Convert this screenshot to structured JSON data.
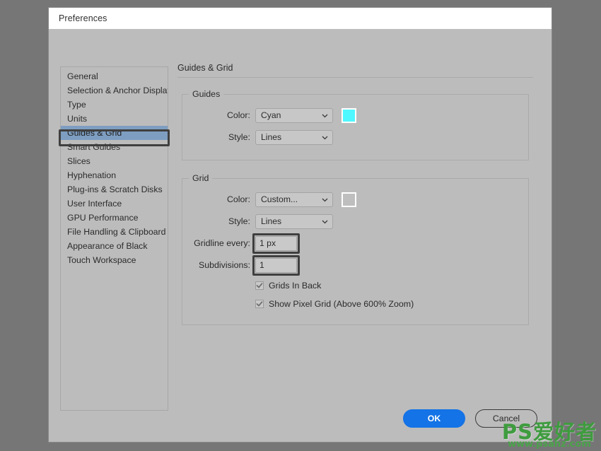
{
  "window": {
    "title": "Preferences"
  },
  "sidebar": {
    "items": [
      {
        "label": "General",
        "selected": false
      },
      {
        "label": "Selection & Anchor Display",
        "selected": false
      },
      {
        "label": "Type",
        "selected": false
      },
      {
        "label": "Units",
        "selected": false
      },
      {
        "label": "Guides & Grid",
        "selected": true
      },
      {
        "label": "Smart Guides",
        "selected": false
      },
      {
        "label": "Slices",
        "selected": false
      },
      {
        "label": "Hyphenation",
        "selected": false
      },
      {
        "label": "Plug-ins & Scratch Disks",
        "selected": false
      },
      {
        "label": "User Interface",
        "selected": false
      },
      {
        "label": "GPU Performance",
        "selected": false
      },
      {
        "label": "File Handling & Clipboard",
        "selected": false
      },
      {
        "label": "Appearance of Black",
        "selected": false
      },
      {
        "label": "Touch Workspace",
        "selected": false
      }
    ]
  },
  "panel": {
    "title": "Guides & Grid",
    "guides": {
      "legend": "Guides",
      "color_label": "Color:",
      "color_value": "Cyan",
      "color_swatch": "#4ff7ff",
      "style_label": "Style:",
      "style_value": "Lines"
    },
    "grid": {
      "legend": "Grid",
      "color_label": "Color:",
      "color_value": "Custom...",
      "color_swatch": "#bebebe",
      "style_label": "Style:",
      "style_value": "Lines",
      "gridline_label": "Gridline every:",
      "gridline_value": "1 px",
      "subdivisions_label": "Subdivisions:",
      "subdivisions_value": "1",
      "grids_in_back_label": "Grids In Back",
      "grids_in_back_checked": true,
      "show_pixel_grid_label": "Show Pixel Grid (Above 600% Zoom)",
      "show_pixel_grid_checked": true
    }
  },
  "footer": {
    "ok_label": "OK",
    "cancel_label": "Cancel"
  },
  "watermark": {
    "main": "PS爱好者",
    "sub": "www.psahz.com"
  },
  "colors": {
    "desktop": "#767676",
    "dialog": "#bcbcbc",
    "titlebar": "#ffffff",
    "selection": "#7e9ec1",
    "accent": "#1473e6",
    "annotation": "#3f3f3f"
  }
}
